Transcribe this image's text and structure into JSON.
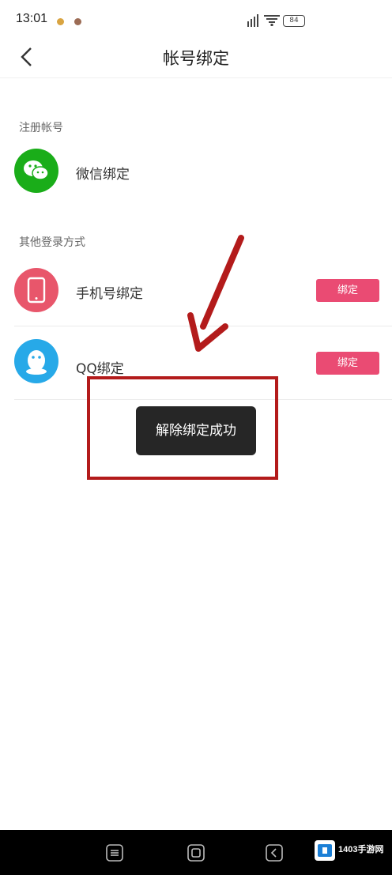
{
  "status_bar": {
    "time": "13:01",
    "battery": "84"
  },
  "header": {
    "title": "帐号绑定"
  },
  "sections": {
    "register": {
      "heading": "注册帐号",
      "wechat_label": "微信绑定"
    },
    "other": {
      "heading": "其他登录方式",
      "phone_label": "手机号绑定",
      "phone_button": "绑定",
      "qq_label": "QQ绑定",
      "qq_button": "绑定"
    }
  },
  "toast": {
    "message": "解除绑定成功"
  },
  "watermark": {
    "text": "1403手游网"
  },
  "colors": {
    "wechat": "#1aad19",
    "phone": "#e8566b",
    "qq": "#27a9e8",
    "button": "#ea4b73",
    "annotation": "#b31b1b"
  }
}
